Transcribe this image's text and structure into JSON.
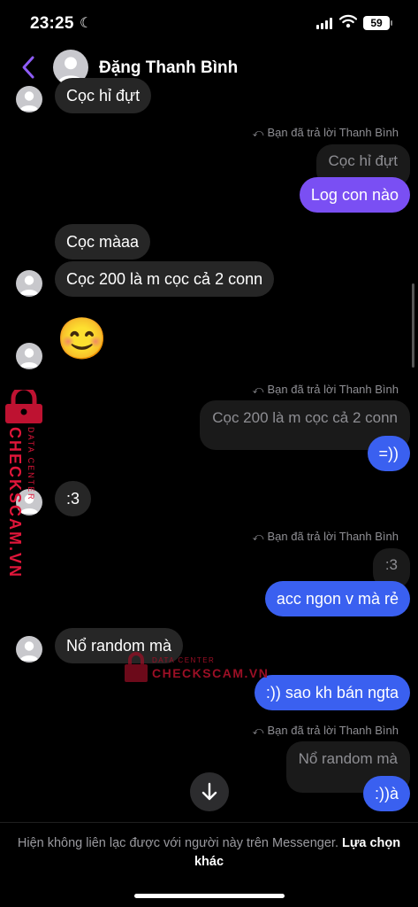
{
  "status_bar": {
    "time": "23:25",
    "battery": "59"
  },
  "header": {
    "contact_name": "Đặng Thanh Bình"
  },
  "messages": {
    "m1": "Cọc hỉ đựt",
    "reply1": {
      "note": "Bạn đã trả lời Thanh Bình",
      "quoted": "Cọc hỉ đựt",
      "text": "Log con nào"
    },
    "m2": "Cọc màaa",
    "m3": "Cọc 200 là m cọc cả 2 conn",
    "emoji": "😊",
    "reply2": {
      "note": "Bạn đã trả lời Thanh Bình",
      "quoted": "Cọc 200 là m cọc cả 2 conn",
      "text": "=))"
    },
    "m4": ":3",
    "reply3": {
      "note": "Bạn đã trả lời Thanh Bình",
      "quoted": ":3",
      "text": "acc ngon v mà rẻ"
    },
    "m5": "Nổ random mà",
    "out4": ":)) sao kh bán ngta",
    "reply4": {
      "note": "Bạn đã trả lời Thanh Bình",
      "quoted": "Nổ random mà",
      "text": ":))à"
    }
  },
  "footer": {
    "notice": "Hiện không liên lạc được với người này trên Messenger.",
    "link": "Lựa chọn khác"
  },
  "watermark": {
    "brand": "CHECKSCAM.VN",
    "sub": "DATA CENTER"
  },
  "colors": {
    "outgoing": "#3a60f0",
    "outgoing_top": "#7a4ff3",
    "incoming": "#262626",
    "accent": "#8e5cf7",
    "watermark": "#e0163a"
  }
}
